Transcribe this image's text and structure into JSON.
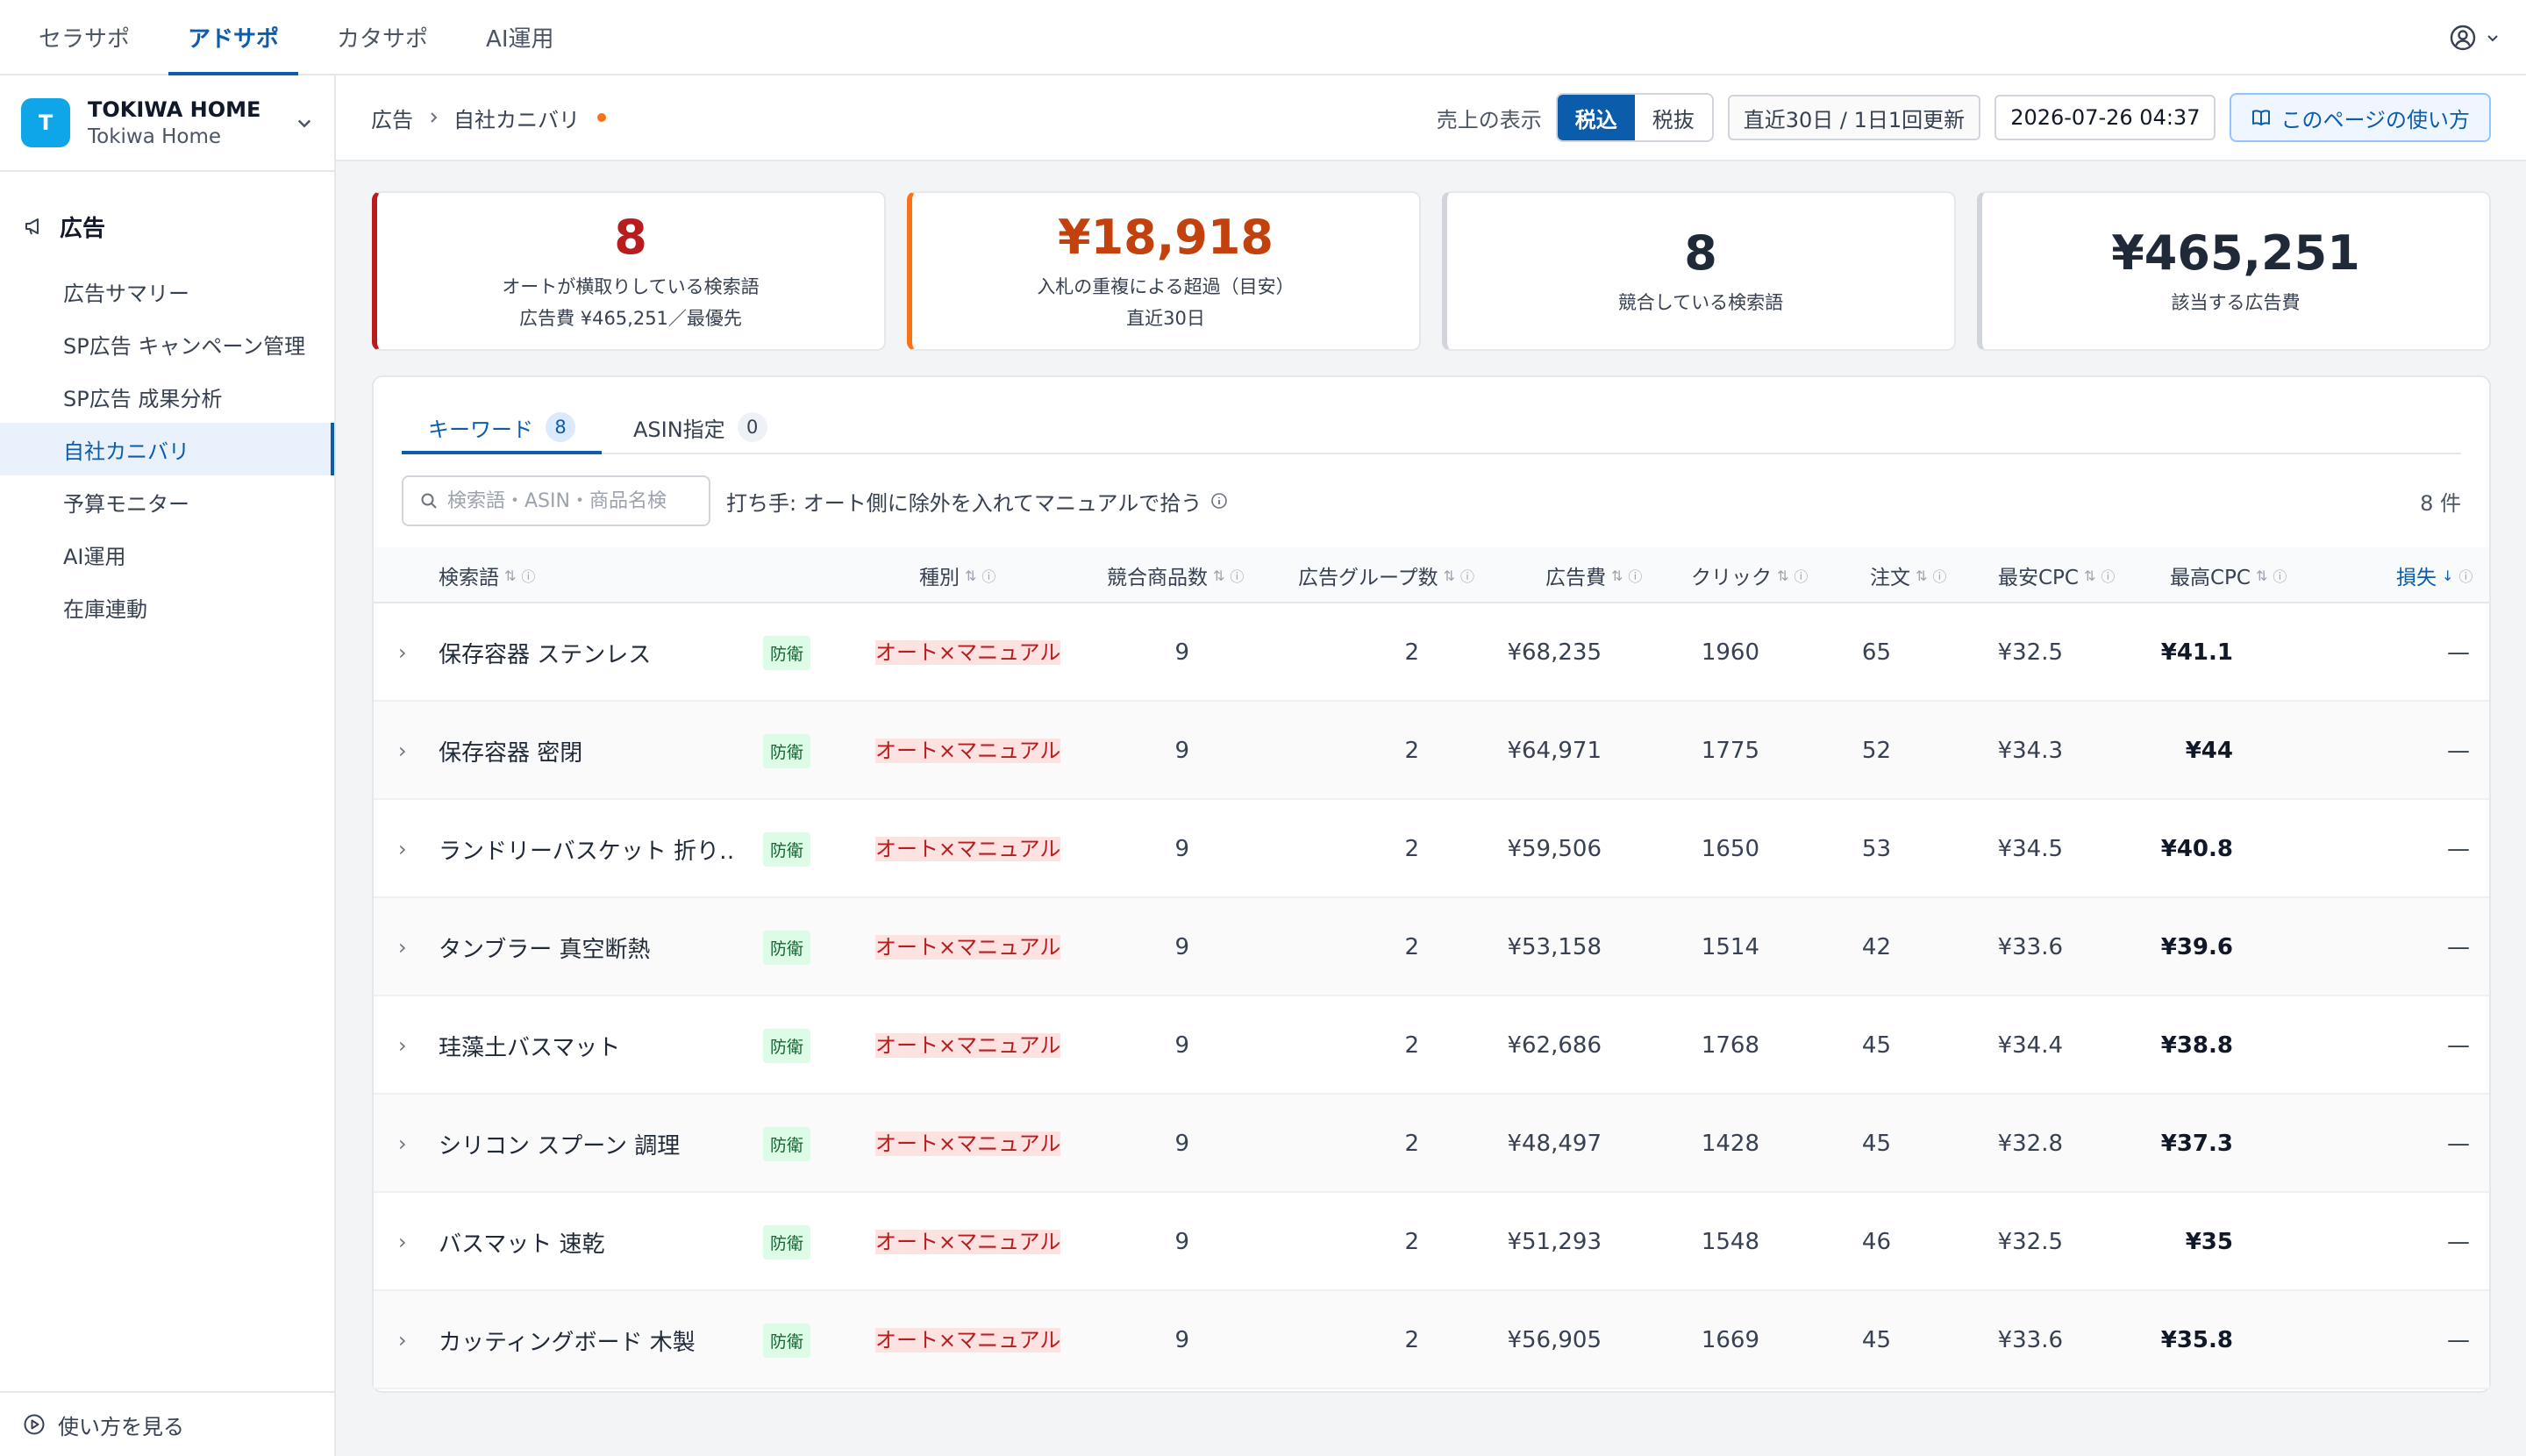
{
  "topnav": {
    "tabs": [
      {
        "label": "セラサポ",
        "active": false
      },
      {
        "label": "アドサポ",
        "active": true
      },
      {
        "label": "カタサポ",
        "active": false
      },
      {
        "label": "AI運用",
        "active": false
      }
    ]
  },
  "account": {
    "initial": "T",
    "name": "TOKIWA HOME",
    "sub": "Tokiwa Home"
  },
  "sidebar": {
    "section": "広告",
    "items": [
      {
        "label": "広告サマリー",
        "active": false
      },
      {
        "label": "SP広告 キャンペーン管理",
        "active": false
      },
      {
        "label": "SP広告 成果分析",
        "active": false
      },
      {
        "label": "自社カニバリ",
        "active": true
      },
      {
        "label": "予算モニター",
        "active": false
      },
      {
        "label": "AI運用",
        "active": false
      },
      {
        "label": "在庫連動",
        "active": false
      }
    ],
    "footer": "使い方を見る"
  },
  "header": {
    "breadcrumb_parent": "広告",
    "breadcrumb_current": "自社カニバリ",
    "sales_label": "売上の表示",
    "tax_in": "税込",
    "tax_out": "税抜",
    "period": "直近30日 / 1日1回更新",
    "updated_at": "2026-07-26 04:37",
    "help": "このページの使い方"
  },
  "cards": [
    {
      "value": "8",
      "line1": "オートが横取りしている検索語",
      "line2": "広告費 ¥465,251／最優先",
      "color": "#b91c1c"
    },
    {
      "value": "¥18,918",
      "line1": "入札の重複による超過（目安）",
      "line2": "直近30日",
      "color": "#c2410c"
    },
    {
      "value": "8",
      "line1": "競合している検索語",
      "line2": "",
      "color": "#111827"
    },
    {
      "value": "¥465,251",
      "line1": "該当する広告費",
      "line2": "",
      "color": "#111827"
    }
  ],
  "tabs": [
    {
      "label": "キーワード",
      "count": "8",
      "active": true
    },
    {
      "label": "ASIN指定",
      "count": "0",
      "active": false
    }
  ],
  "toolbar": {
    "search_placeholder": "検索語・ASIN・商品名検",
    "hint": "打ち手: オート側に除外を入れてマニュアルで拾う",
    "count": "8 件"
  },
  "table": {
    "columns": [
      "検索語",
      "種別",
      "競合商品数",
      "広告グループ数",
      "広告費",
      "クリック",
      "注文",
      "最安CPC",
      "最高CPC",
      "損失"
    ],
    "sorted_column": "損失",
    "rows": [
      {
        "keyword": "保存容器 ステンレス",
        "tag": "防衛",
        "type": "オート×マニュアル",
        "products": "9",
        "groups": "2",
        "cost": "¥68,235",
        "clicks": "1960",
        "orders": "65",
        "min_cpc": "¥32.5",
        "max_cpc": "¥41.1",
        "loss": "—"
      },
      {
        "keyword": "保存容器 密閉",
        "tag": "防衛",
        "type": "オート×マニュアル",
        "products": "9",
        "groups": "2",
        "cost": "¥64,971",
        "clicks": "1775",
        "orders": "52",
        "min_cpc": "¥34.3",
        "max_cpc": "¥44",
        "loss": "—"
      },
      {
        "keyword": "ランドリーバスケット 折り…",
        "tag": "防衛",
        "type": "オート×マニュアル",
        "products": "9",
        "groups": "2",
        "cost": "¥59,506",
        "clicks": "1650",
        "orders": "53",
        "min_cpc": "¥34.5",
        "max_cpc": "¥40.8",
        "loss": "—"
      },
      {
        "keyword": "タンブラー 真空断熱",
        "tag": "防衛",
        "type": "オート×マニュアル",
        "products": "9",
        "groups": "2",
        "cost": "¥53,158",
        "clicks": "1514",
        "orders": "42",
        "min_cpc": "¥33.6",
        "max_cpc": "¥39.6",
        "loss": "—"
      },
      {
        "keyword": "珪藻土バスマット",
        "tag": "防衛",
        "type": "オート×マニュアル",
        "products": "9",
        "groups": "2",
        "cost": "¥62,686",
        "clicks": "1768",
        "orders": "45",
        "min_cpc": "¥34.4",
        "max_cpc": "¥38.8",
        "loss": "—"
      },
      {
        "keyword": "シリコン スプーン 調理",
        "tag": "防衛",
        "type": "オート×マニュアル",
        "products": "9",
        "groups": "2",
        "cost": "¥48,497",
        "clicks": "1428",
        "orders": "45",
        "min_cpc": "¥32.8",
        "max_cpc": "¥37.3",
        "loss": "—"
      },
      {
        "keyword": "バスマット 速乾",
        "tag": "防衛",
        "type": "オート×マニュアル",
        "products": "9",
        "groups": "2",
        "cost": "¥51,293",
        "clicks": "1548",
        "orders": "46",
        "min_cpc": "¥32.5",
        "max_cpc": "¥35",
        "loss": "—"
      },
      {
        "keyword": "カッティングボード 木製",
        "tag": "防衛",
        "type": "オート×マニュアル",
        "products": "9",
        "groups": "2",
        "cost": "¥56,905",
        "clicks": "1669",
        "orders": "45",
        "min_cpc": "¥33.6",
        "max_cpc": "¥35.8",
        "loss": "—"
      }
    ]
  }
}
